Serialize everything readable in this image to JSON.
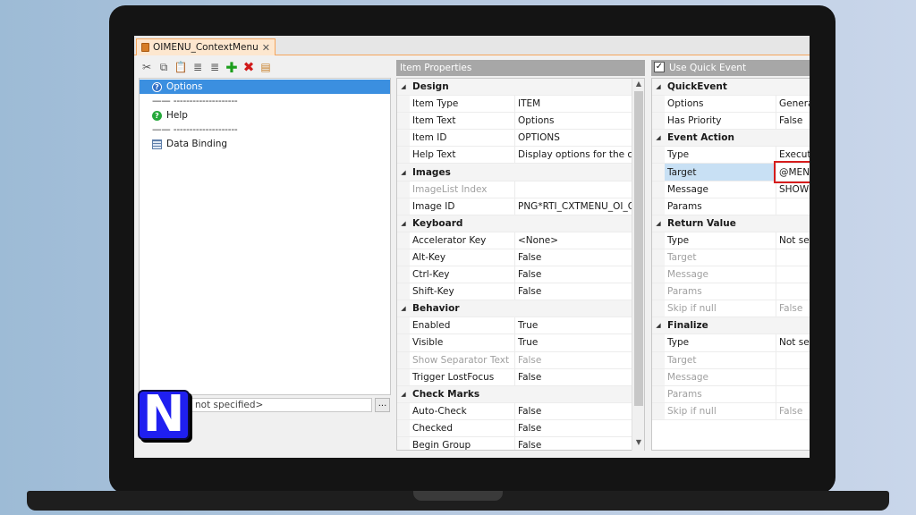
{
  "document_tab": {
    "title": "OIMENU_ContextMenu",
    "close_glyph": "✕"
  },
  "toolbar": {
    "buttons": [
      {
        "icon": "cut-icon",
        "glyph": "✂"
      },
      {
        "icon": "copy-icon",
        "glyph": "⧉"
      },
      {
        "icon": "paste-icon",
        "glyph": "📋"
      },
      {
        "icon": "indent-icon",
        "glyph": "≣"
      },
      {
        "icon": "outdent-icon",
        "glyph": "≣"
      },
      {
        "icon": "add-icon",
        "glyph": "✚"
      },
      {
        "icon": "delete-icon",
        "glyph": "✖"
      },
      {
        "icon": "properties-icon",
        "glyph": "▤"
      }
    ]
  },
  "tree": {
    "items": [
      {
        "label": "Options",
        "icon": "question-icon",
        "selected": true
      },
      {
        "label": "——  --------------------",
        "separator": true
      },
      {
        "label": "Help",
        "icon": "help-icon"
      },
      {
        "label": "——  --------------------",
        "separator": true
      },
      {
        "label": "Data Binding",
        "icon": "data-binding-icon"
      }
    ]
  },
  "bottom_field": {
    "value": "not specified>"
  },
  "ellipsis_label": "...",
  "logo_letter": "N",
  "item_properties": {
    "header": "Item Properties",
    "rows": [
      {
        "type": "cat",
        "name": "Design"
      },
      {
        "name": "Item Type",
        "value": "ITEM"
      },
      {
        "name": "Item Text",
        "value": "Options"
      },
      {
        "name": "Item ID",
        "value": "OPTIONS"
      },
      {
        "name": "Help Text",
        "value": "Display options for the curr"
      },
      {
        "type": "cat",
        "name": "Images"
      },
      {
        "name": "ImageList Index",
        "value": "",
        "dim": true
      },
      {
        "name": "Image ID",
        "value": "PNG*RTI_CXTMENU_OI_OPT"
      },
      {
        "type": "cat",
        "name": "Keyboard"
      },
      {
        "name": "Accelerator Key",
        "value": "<None>"
      },
      {
        "name": "Alt-Key",
        "value": "False"
      },
      {
        "name": "Ctrl-Key",
        "value": "False"
      },
      {
        "name": "Shift-Key",
        "value": "False"
      },
      {
        "type": "cat",
        "name": "Behavior"
      },
      {
        "name": "Enabled",
        "value": "True"
      },
      {
        "name": "Visible",
        "value": "True"
      },
      {
        "name": "Show Separator Text",
        "value": "False",
        "dim": true
      },
      {
        "name": "Trigger LostFocus",
        "value": "False"
      },
      {
        "type": "cat",
        "name": "Check Marks"
      },
      {
        "name": "Auto-Check",
        "value": "False"
      },
      {
        "name": "Checked",
        "value": "False"
      },
      {
        "name": "Begin Group",
        "value": "False"
      }
    ]
  },
  "quick_event": {
    "header": "Use Quick Event",
    "checked": true,
    "check_glyph": "✓",
    "rows": [
      {
        "type": "cat",
        "name": "QuickEvent"
      },
      {
        "name": "Options",
        "value": "Genera"
      },
      {
        "name": "Has Priority",
        "value": "False"
      },
      {
        "type": "cat",
        "name": "Event Action"
      },
      {
        "name": "Type",
        "value": "Execute"
      },
      {
        "name": "Target",
        "value": "@MENU",
        "highlight": true
      },
      {
        "name": "Message",
        "value": "SHOWO"
      },
      {
        "name": "Params",
        "value": ""
      },
      {
        "type": "cat",
        "name": "Return Value"
      },
      {
        "name": "Type",
        "value": "Not set"
      },
      {
        "name": "Target",
        "value": "",
        "dim": true
      },
      {
        "name": "Message",
        "value": "",
        "dim": true
      },
      {
        "name": "Params",
        "value": "",
        "dim": true
      },
      {
        "name": "Skip if null",
        "value": "False",
        "dim": true
      },
      {
        "type": "cat",
        "name": "Finalize"
      },
      {
        "name": "Type",
        "value": "Not set"
      },
      {
        "name": "Target",
        "value": "",
        "dim": true
      },
      {
        "name": "Message",
        "value": "",
        "dim": true
      },
      {
        "name": "Params",
        "value": "",
        "dim": true
      },
      {
        "name": "Skip if null",
        "value": "False",
        "dim": true
      }
    ]
  },
  "scroll_arrows": {
    "up": "▲",
    "down": "▼"
  },
  "collapse_glyph": "◢",
  "colors": {
    "selection": "#3b8fe0",
    "highlight_border": "#d61d1d",
    "tab_accent": "#f5a55c"
  }
}
